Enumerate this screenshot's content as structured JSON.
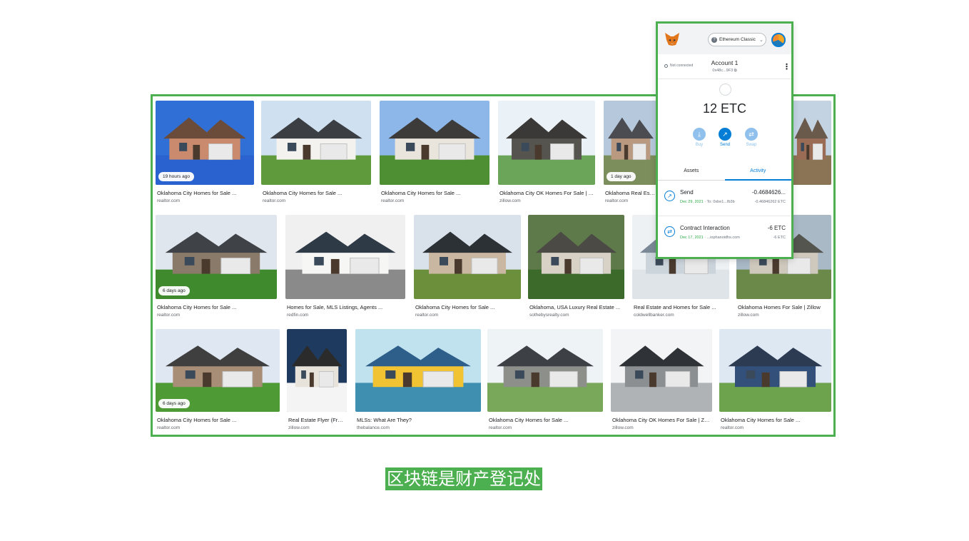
{
  "image_results": [
    {
      "caption": "Oklahoma City Homes for Sale ...",
      "source": "realtor.com",
      "badge": "19 hours ago",
      "sky": "#2f6fd6",
      "house": "#c98a6e",
      "roof": "#6b4c3b",
      "ground": "#2a63d0"
    },
    {
      "caption": "Oklahoma City Homes for Sale ...",
      "source": "realtor.com",
      "badge": "",
      "sky": "#cfe0f1",
      "house": "#f4f2ee",
      "roof": "#3b3f44",
      "ground": "#5f9a3c"
    },
    {
      "caption": "Oklahoma City Homes for Sale ...",
      "source": "realtor.com",
      "badge": "",
      "sky": "#8db7e8",
      "house": "#e9e4dc",
      "roof": "#3d3b3a",
      "ground": "#4f8f34"
    },
    {
      "caption": "Oklahoma City OK Homes For Sale | Zill...",
      "source": "zillow.com",
      "badge": "",
      "sky": "#eaf2f7",
      "house": "#56544f",
      "roof": "#3a3937",
      "ground": "#6aa55a"
    },
    {
      "caption": "Oklahoma Real Estate",
      "source": "realtor.com",
      "badge": "1 day ago",
      "sky": "#b6c9dc",
      "house": "#b99a80",
      "roof": "#4a4c51",
      "ground": "#7c8e5c"
    },
    {
      "caption": "",
      "source": "",
      "badge": "",
      "sky": "#c3d3e2",
      "house": "#9a6c55",
      "roof": "#6a5a4c",
      "ground": "#8b7456"
    },
    {
      "caption": "Oklahoma City Homes for Sale ...",
      "source": "realtor.com",
      "badge": "6 days ago",
      "sky": "#dfe6ee",
      "house": "#8a7a6a",
      "roof": "#3f4246",
      "ground": "#3f8a2c"
    },
    {
      "caption": "Homes for Sale, MLS Listings, Agents ...",
      "source": "redfin.com",
      "badge": "",
      "sky": "#f0f0f0",
      "house": "#f6f6f4",
      "roof": "#2f3a47",
      "ground": "#8a8a8a"
    },
    {
      "caption": "Oklahoma City Homes for Sale ...",
      "source": "realtor.com",
      "badge": "",
      "sky": "#d9e2ea",
      "house": "#c9b7a2",
      "roof": "#2c3136",
      "ground": "#6b8f3a"
    },
    {
      "caption": "Oklahoma, USA Luxury Real Estate ...",
      "source": "sothebysrealty.com",
      "badge": "",
      "sky": "#5e7a4a",
      "house": "#d7d1c6",
      "roof": "#4b4a45",
      "ground": "#3c6a2a"
    },
    {
      "caption": "Real Estate and Homes for Sale ...",
      "source": "coldwellbanker.com",
      "badge": "",
      "sky": "#eef1f4",
      "house": "#cbd3db",
      "roof": "#7b8896",
      "ground": "#dfe4e9"
    },
    {
      "caption": "Oklahoma Homes For Sale | Zillow",
      "source": "zillow.com",
      "badge": "",
      "sky": "#a9b9c6",
      "house": "#cfc8bc",
      "roof": "#55554f",
      "ground": "#6b8a4a"
    },
    {
      "caption": "Oklahoma City Homes for Sale ...",
      "source": "realtor.com",
      "badge": "6 days ago",
      "sky": "#dfe8f2",
      "house": "#a88e76",
      "roof": "#3f3f40",
      "ground": "#4e9a34"
    },
    {
      "caption": "Real Estate Flyer (Free ...",
      "source": "zillow.com",
      "badge": "",
      "sky": "#1f3a5f",
      "house": "#e7e3db",
      "roof": "#2b2b2b",
      "ground": "#f4f4f4"
    },
    {
      "caption": "MLSs: What Are They?",
      "source": "thebalance.com",
      "badge": "",
      "sky": "#bfe2ee",
      "house": "#f1c232",
      "roof": "#2e5e8a",
      "ground": "#3e8fb0"
    },
    {
      "caption": "Oklahoma City Homes for Sale ...",
      "source": "realtor.com",
      "badge": "",
      "sky": "#eef3f6",
      "house": "#8d8f8a",
      "roof": "#3d4045",
      "ground": "#79a85a"
    },
    {
      "caption": "Oklahoma City OK Homes For Sale | Zillow",
      "source": "zillow.com",
      "badge": "",
      "sky": "#f2f4f5",
      "house": "#8c8f92",
      "roof": "#2f3236",
      "ground": "#b0b3b5"
    },
    {
      "caption": "Oklahoma City Homes for Sale ...",
      "source": "realtor.com",
      "badge": "",
      "sky": "#dde8f2",
      "house": "#33507a",
      "roof": "#2c3b52",
      "ground": "#6ea34e"
    }
  ],
  "footer_caption": "区块链是财产登记处",
  "wallet": {
    "network": "Ethereum Classic",
    "connection_status": "Not connected",
    "account_name": "Account 1",
    "account_address": "0x48c...9F3",
    "balance": "12 ETC",
    "actions": {
      "buy": "Buy",
      "send": "Send",
      "swap": "Swap"
    },
    "tabs": {
      "assets": "Assets",
      "activity": "Activity"
    },
    "transactions": [
      {
        "title": "Send",
        "date": "Dec 29, 2021",
        "detail": " · To: 0xbe1...fb3b",
        "amount": "-0.4684626...",
        "fiat": "-0.46846262 ETC",
        "icon": "send-arrow-icon"
      },
      {
        "title": "Contract Interaction",
        "date": "Dec 17, 2021",
        "detail": " · ...iophanoidhs.com",
        "amount": "-6 ETC",
        "fiat": "-6 ETC",
        "icon": "swap-arrows-icon"
      }
    ],
    "colors": {
      "primary": "#037dd6",
      "primary_light": "#8fc1ec",
      "success": "#28a745"
    }
  },
  "colors": {
    "highlight_border": "#4caf50"
  }
}
